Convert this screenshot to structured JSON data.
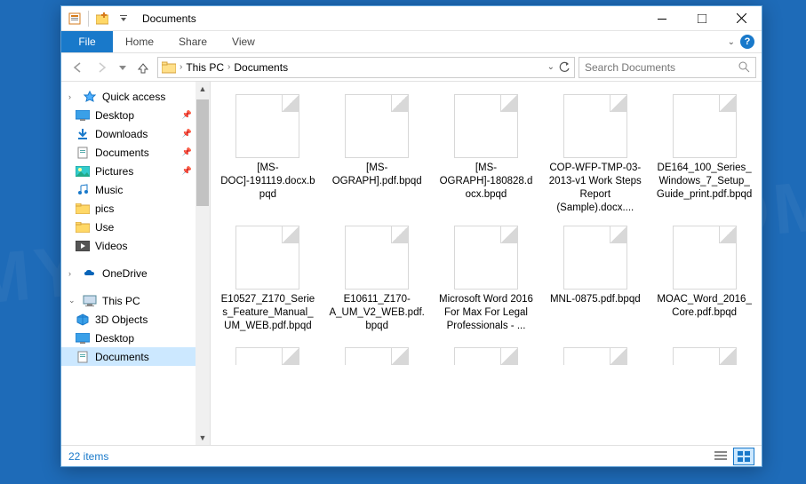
{
  "window": {
    "title": "Documents"
  },
  "ribbon": {
    "file": "File",
    "tabs": [
      "Home",
      "Share",
      "View"
    ]
  },
  "breadcrumb": {
    "items": [
      "This PC",
      "Documents"
    ]
  },
  "search": {
    "placeholder": "Search Documents"
  },
  "sidebar": {
    "quick_access": {
      "label": "Quick access",
      "items": [
        {
          "label": "Desktop",
          "icon": "desktop",
          "pinned": true
        },
        {
          "label": "Downloads",
          "icon": "downloads",
          "pinned": true
        },
        {
          "label": "Documents",
          "icon": "documents",
          "pinned": true
        },
        {
          "label": "Pictures",
          "icon": "pictures",
          "pinned": true
        },
        {
          "label": "Music",
          "icon": "music",
          "pinned": false
        },
        {
          "label": "pics",
          "icon": "folder",
          "pinned": false
        },
        {
          "label": "Use",
          "icon": "folder",
          "pinned": false
        },
        {
          "label": "Videos",
          "icon": "videos",
          "pinned": false
        }
      ]
    },
    "onedrive": {
      "label": "OneDrive"
    },
    "this_pc": {
      "label": "This PC",
      "items": [
        {
          "label": "3D Objects",
          "icon": "3d"
        },
        {
          "label": "Desktop",
          "icon": "desktop"
        },
        {
          "label": "Documents",
          "icon": "documents",
          "selected": true
        }
      ]
    }
  },
  "files": [
    {
      "name": "[MS-DOC]-191119.docx.bpqd"
    },
    {
      "name": "[MS-OGRAPH].pdf.bpqd"
    },
    {
      "name": "[MS-OGRAPH]-180828.docx.bpqd"
    },
    {
      "name": "COP-WFP-TMP-03-2013-v1 Work Steps Report (Sample).docx...."
    },
    {
      "name": "DE164_100_Series_Windows_7_Setup_Guide_print.pdf.bpqd"
    },
    {
      "name": "E10527_Z170_Series_Feature_Manual_UM_WEB.pdf.bpqd"
    },
    {
      "name": "E10611_Z170-A_UM_V2_WEB.pdf.bpqd"
    },
    {
      "name": "Microsoft Word 2016 For Max For Legal Professionals - ..."
    },
    {
      "name": "MNL-0875.pdf.bpqd"
    },
    {
      "name": "MOAC_Word_2016_Core.pdf.bpqd"
    }
  ],
  "partial_files_row3": true,
  "status": {
    "count": "22 items"
  }
}
